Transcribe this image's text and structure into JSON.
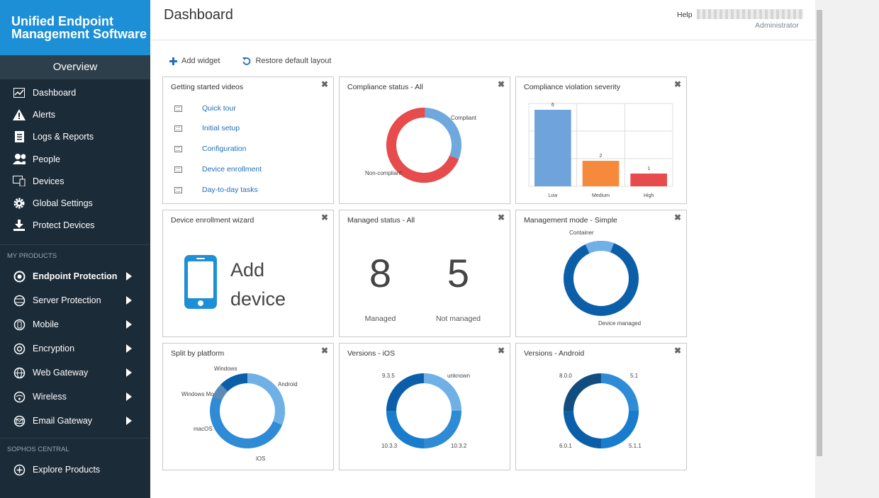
{
  "brand": {
    "line1": "Unified Endpoint",
    "line2": "Management Software"
  },
  "sidebar": {
    "overview": "Overview",
    "nav": [
      {
        "label": "Dashboard",
        "icon": "dashboard-icon"
      },
      {
        "label": "Alerts",
        "icon": "alert-icon"
      },
      {
        "label": "Logs & Reports",
        "icon": "report-icon"
      },
      {
        "label": "People",
        "icon": "people-icon"
      },
      {
        "label": "Devices",
        "icon": "devices-icon"
      },
      {
        "label": "Global Settings",
        "icon": "gear-icon"
      },
      {
        "label": "Protect Devices",
        "icon": "download-icon"
      }
    ],
    "my_products_heading": "MY PRODUCTS",
    "products": [
      {
        "label": "Endpoint Protection",
        "active": true
      },
      {
        "label": "Server Protection"
      },
      {
        "label": "Mobile"
      },
      {
        "label": "Encryption"
      },
      {
        "label": "Web Gateway"
      },
      {
        "label": "Wireless"
      },
      {
        "label": "Email Gateway"
      }
    ],
    "central_heading": "SOPHOS CENTRAL",
    "explore": "Explore Products"
  },
  "header": {
    "title": "Dashboard",
    "help": "Help",
    "role": "Administrator"
  },
  "toolbar": {
    "add_widget": "Add widget",
    "restore": "Restore default layout"
  },
  "colors": {
    "accent": "#1d8fd6",
    "sidebar": "#1b2b38",
    "link": "#1e6fb8",
    "compliant": "#6fa8dc",
    "noncompliant": "#e84b4b",
    "medium": "#f58a3c",
    "donut_dark": "#0b5fa8",
    "donut_mid": "#2f8bd6",
    "donut_light": "#6fb1e6"
  },
  "widgets": {
    "videos": {
      "title": "Getting started videos",
      "items": [
        "Quick tour",
        "Initial setup",
        "Configuration",
        "Device enrollment",
        "Day-to-day tasks"
      ]
    },
    "compliance": {
      "title": "Compliance status - All",
      "labels": {
        "compliant": "Compliant",
        "noncompliant": "Non-compliant"
      }
    },
    "severity": {
      "title": "Compliance violation severity"
    },
    "enroll": {
      "title": "Device enrollment wizard",
      "line1": "Add",
      "line2": "device"
    },
    "managed": {
      "title": "Managed status - All",
      "managed_value": "8",
      "managed_label": "Managed",
      "not_value": "5",
      "not_label": "Not managed"
    },
    "mode": {
      "title": "Management mode - Simple",
      "container": "Container",
      "device_managed": "Device managed"
    },
    "platform": {
      "title": "Split by platform",
      "labels": [
        "Windows",
        "Android",
        "Windows Mo",
        "macOS",
        "iOS"
      ]
    },
    "ios": {
      "title": "Versions - iOS",
      "labels": [
        "9.3.5",
        "unknown",
        "10.3.3",
        "10.3.2"
      ]
    },
    "android": {
      "title": "Versions - Android",
      "labels": [
        "8.0.0",
        "5.1",
        "6.0.1",
        "5.1.1"
      ]
    }
  },
  "chart_data": [
    {
      "type": "bar",
      "title": "Compliance violation severity",
      "categories": [
        "Low",
        "Medium",
        "High"
      ],
      "values": [
        6,
        2,
        1
      ],
      "colors": [
        "#6fa3dc",
        "#f58a3c",
        "#e84b4b"
      ]
    }
  ]
}
